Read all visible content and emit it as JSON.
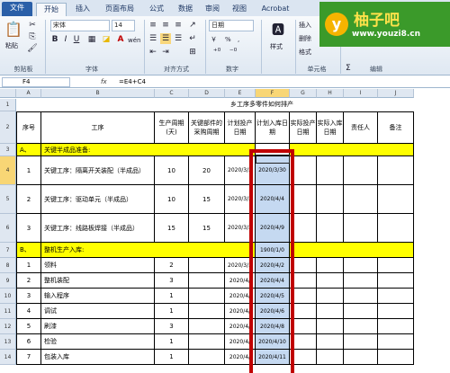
{
  "ribbon_tabs": [
    "文件",
    "开始",
    "插入",
    "页面布局",
    "公式",
    "数据",
    "审阅",
    "视图",
    "Acrobat"
  ],
  "clipboard": {
    "paste": "粘贴",
    "label": "剪贴板"
  },
  "font": {
    "name": "宋体",
    "size": "14",
    "bold": "B",
    "italic": "I",
    "underline": "U",
    "color_a": "A",
    "wen": "wén",
    "label": "字体"
  },
  "alignment": {
    "label": "对齐方式"
  },
  "number": {
    "format": "日期",
    "currency": "￥",
    "percent": "%",
    "comma": ",",
    "label": "数字"
  },
  "styles": {
    "style": "样式",
    "label": ""
  },
  "cells": {
    "insert": "插入",
    "delete": "删除",
    "format": "格式",
    "label": "单元格"
  },
  "editing": {
    "sigma": "Σ",
    "label": "编辑"
  },
  "logo": {
    "initial": "y",
    "name": "柚子吧",
    "url": "www.youzi8.cn"
  },
  "formula_bar": {
    "name_box": "F4",
    "fx": "fx",
    "formula": "=E4+C4"
  },
  "col_headers": [
    "A",
    "B",
    "C",
    "D",
    "E",
    "F",
    "G",
    "H",
    "I",
    "J"
  ],
  "sheet_title": "乡工序多零件如何排产",
  "table_headers": [
    "序号",
    "工序",
    "生产周期(天)",
    "关键部件的采购周期",
    "计划投产日期",
    "计划入库日期",
    "实际投产日期",
    "实际入库日期",
    "责任人",
    "备注"
  ],
  "rows": [
    {
      "row": "1",
      "cells": [
        "",
        "",
        "",
        "",
        "",
        "",
        "",
        "",
        "",
        ""
      ]
    },
    {
      "row": "2",
      "cells": [
        "",
        "",
        "",
        "",
        "",
        "",
        "",
        "",
        "",
        ""
      ]
    },
    {
      "row": "3",
      "cells": [
        "A、",
        "关键半成品准备:",
        "",
        "",
        "",
        "",
        "",
        "",
        "",
        ""
      ]
    },
    {
      "row": "4",
      "cells": [
        "1",
        "关键工序：隔离开关装配（半成品）",
        "10",
        "20",
        "2020/3/2",
        "2020/3/30",
        "",
        "",
        "",
        ""
      ]
    },
    {
      "row": "5",
      "cells": [
        "2",
        "关键工序：驱动单元（半成品）",
        "10",
        "15",
        "2020/3/2",
        "2020/4/4",
        "",
        "",
        "",
        ""
      ]
    },
    {
      "row": "6",
      "cells": [
        "3",
        "关键工序：线路板焊接（半成品）",
        "15",
        "15",
        "2020/3/2",
        "2020/4/9",
        "",
        "",
        "",
        ""
      ]
    },
    {
      "row": "7",
      "cells": [
        "B、",
        "整机生产入库:",
        "",
        "",
        "",
        "1900/1/0",
        "",
        "",
        "",
        ""
      ]
    },
    {
      "row": "8",
      "cells": [
        "1",
        "领料",
        "2",
        "",
        "2020/3/3",
        "2020/4/2",
        "",
        "",
        "",
        ""
      ]
    },
    {
      "row": "9",
      "cells": [
        "2",
        "整机装配",
        "3",
        "",
        "2020/4/",
        "2020/4/4",
        "",
        "",
        "",
        ""
      ]
    },
    {
      "row": "10",
      "cells": [
        "3",
        "输入程序",
        "1",
        "",
        "2020/4/",
        "2020/4/5",
        "",
        "",
        "",
        ""
      ]
    },
    {
      "row": "11",
      "cells": [
        "4",
        "调试",
        "1",
        "",
        "2020/4/",
        "2020/4/6",
        "",
        "",
        "",
        ""
      ]
    },
    {
      "row": "12",
      "cells": [
        "5",
        "刷漆",
        "3",
        "",
        "2020/4/",
        "2020/4/8",
        "",
        "",
        "",
        ""
      ]
    },
    {
      "row": "13",
      "cells": [
        "6",
        "检验",
        "1",
        "",
        "2020/4/",
        "2020/4/10",
        "",
        "",
        "",
        ""
      ]
    },
    {
      "row": "14",
      "cells": [
        "7",
        "包装入库",
        "1",
        "",
        "2020/4/",
        "2020/4/11",
        "",
        "",
        "",
        ""
      ]
    }
  ],
  "colors": {
    "section_fill": "#ffff00",
    "selected_fill": "#c5d9f1",
    "highlight_box": "#c00000",
    "file_tab": "#2a5fa8",
    "logo_bg": "#3b9a2a"
  }
}
